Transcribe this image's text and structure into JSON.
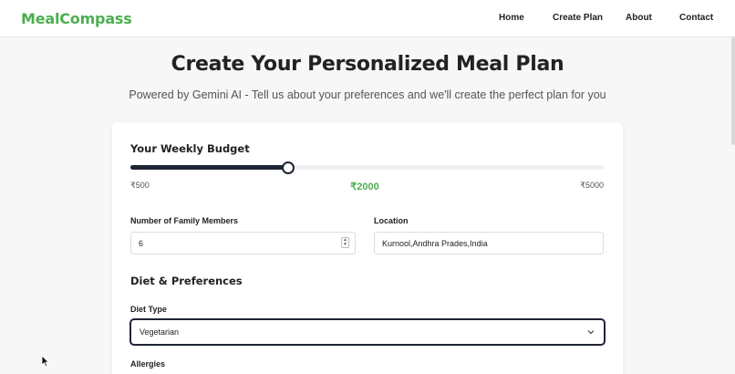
{
  "nav": {
    "brand": "MealCompass",
    "links": [
      "Home",
      "Create Plan",
      "About",
      "Contact"
    ]
  },
  "header": {
    "title": "Create Your Personalized Meal Plan",
    "subtitle": "Powered by Gemini AI - Tell us about your preferences and we'll create the perfect plan for you"
  },
  "budget": {
    "heading": "Your Weekly Budget",
    "min_label": "₹500",
    "max_label": "₹5000",
    "value_label": "₹2000",
    "min": 500,
    "max": 5000,
    "value": 2000
  },
  "family": {
    "label": "Number of Family Members",
    "value": "6"
  },
  "location": {
    "label": "Location",
    "value": "Kurnool,Andhra Prades,India"
  },
  "diet": {
    "heading": "Diet & Preferences",
    "type_label": "Diet Type",
    "type_value": "Vegetarian"
  },
  "allergies": {
    "label": "Allergies"
  },
  "colors": {
    "accent": "#4caf50",
    "slider": "#1e2433",
    "background": "#f7f7f7"
  }
}
